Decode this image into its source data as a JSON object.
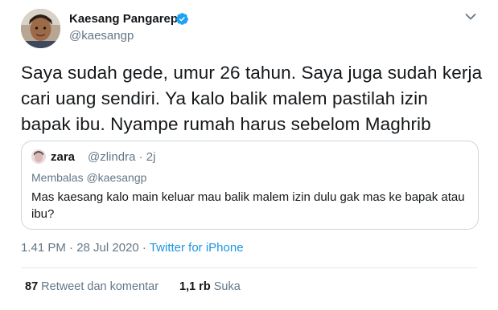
{
  "author": {
    "display_name": "Kaesang Pangarep",
    "handle": "@kaesangp",
    "verified": true
  },
  "tweet": {
    "lines": [
      "Saya sudah gede, umur 26 tahun. Saya juga sudah kerja",
      "cari uang sendiri. Ya kalo balik malem pastilah izin",
      "bapak ibu. Nyampe rumah harus sebelom Maghrib"
    ]
  },
  "quote": {
    "name": "zara",
    "handle": "@zlindra · 2j",
    "reply_to": "Membalas @kaesangp",
    "text": "Mas kaesang kalo main keluar mau balik malem izin dulu gak mas ke bapak atau ibu?"
  },
  "meta": {
    "timestamp": "1.41 PM · 28 Jul 2020 · ",
    "source": "Twitter for iPhone"
  },
  "stats": {
    "retweets_count": "87",
    "retweets_label": "Retweet dan komentar",
    "likes_count": "1,1 rb",
    "likes_label": "Suka"
  },
  "colors": {
    "link": "#1b95e0",
    "verified": "#1da1f2",
    "secondary_text": "#657786"
  },
  "icons": {
    "verified": "verified-badge-icon",
    "menu": "chevron-down-icon"
  }
}
